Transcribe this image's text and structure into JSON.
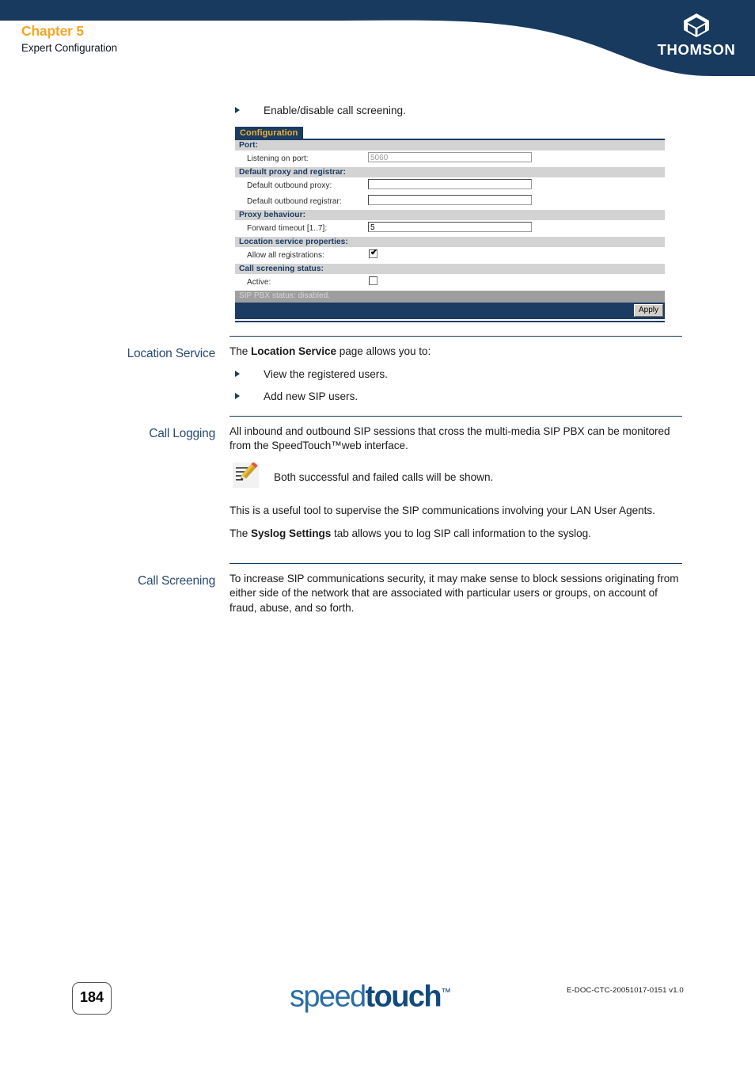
{
  "header": {
    "chapter": "Chapter 5",
    "subtitle": "Expert Configuration",
    "brand": "THOMSON",
    "brand_icon": "thomson-hexagon-icon",
    "bg_color": "#173a5e"
  },
  "intro_bullet": "Enable/disable call screening.",
  "screenshot": {
    "tab_label": "Configuration",
    "sections": [
      {
        "header": "Port:",
        "fields": [
          {
            "label": "Listening on port:",
            "type": "text",
            "value": "5060",
            "disabled": true
          }
        ]
      },
      {
        "header": "Default proxy and registrar:",
        "fields": [
          {
            "label": "Default outbound proxy:",
            "type": "text",
            "value": "",
            "disabled": false
          },
          {
            "label": "Default outbound registrar:",
            "type": "text",
            "value": "",
            "disabled": false
          }
        ]
      },
      {
        "header": "Proxy behaviour:",
        "fields": [
          {
            "label": "Forward timeout [1..7]:",
            "type": "text",
            "value": "5",
            "disabled": false
          }
        ]
      },
      {
        "header": "Location service properties:",
        "fields": [
          {
            "label": "Allow all registrations:",
            "type": "checkbox",
            "checked": true
          }
        ]
      },
      {
        "header": "Call screening status:",
        "fields": [
          {
            "label": "Active:",
            "type": "checkbox",
            "checked": false
          }
        ]
      }
    ],
    "status_text": "SIP PBX status: disabled.",
    "apply_label": "Apply"
  },
  "sections": {
    "location_service": {
      "label": "Location Service",
      "intro_prefix": "The ",
      "intro_bold": "Location Service",
      "intro_suffix": " page allows you to:",
      "bullets": [
        "View the registered users.",
        "Add new SIP users."
      ]
    },
    "call_logging": {
      "label": "Call Logging",
      "para1": "All inbound and outbound SIP sessions that cross the multi-media SIP PBX can be monitored from the SpeedTouch™web interface.",
      "note_icon": "note-pencil-icon",
      "note": "Both successful and failed calls will be shown.",
      "para2": "This is a useful tool to supervise the SIP communications involving your LAN User Agents.",
      "para3_prefix": "The ",
      "para3_bold": "Syslog Settings",
      "para3_suffix": " tab allows you to log SIP call information to the syslog."
    },
    "call_screening": {
      "label": "Call Screening",
      "para1": "To increase SIP communications security, it may make sense to block sessions originating from either side of the network that are associated with particular users or groups, on account of fraud, abuse, and so forth."
    }
  },
  "footer": {
    "page_number": "184",
    "logo_part1": "speed",
    "logo_part2": "touch",
    "logo_tm": "™",
    "doc_code": "E-DOC-CTC-20051017-0151 v1.0"
  }
}
